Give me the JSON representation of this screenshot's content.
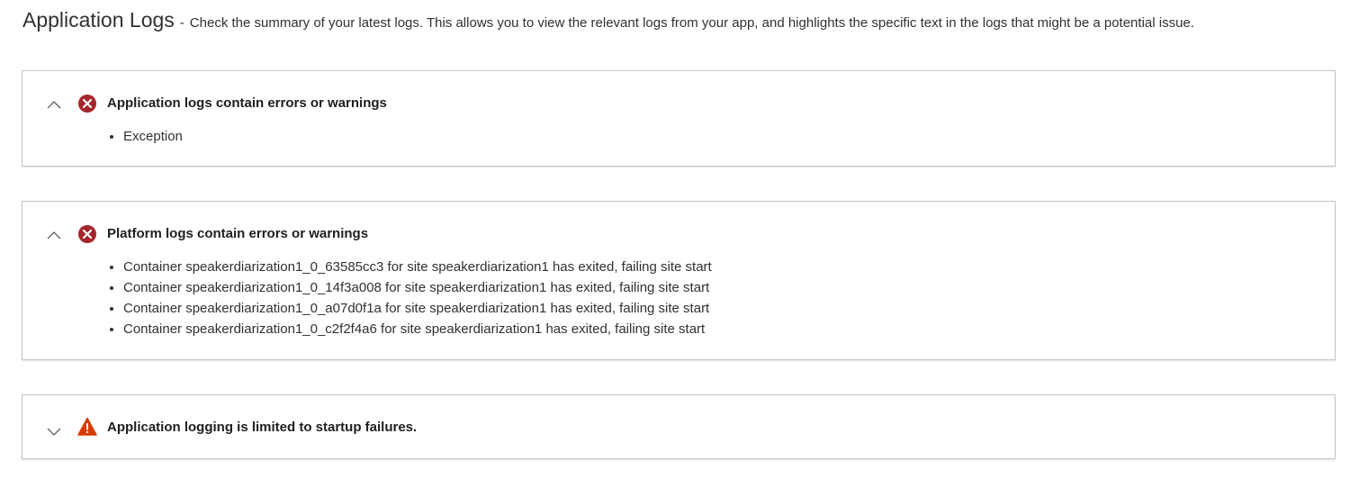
{
  "header": {
    "title": "Application Logs",
    "separator": "-",
    "description": "Check the summary of your latest logs. This allows you to view the relevant logs from your app, and highlights the specific text in the logs that might be a potential issue."
  },
  "cards": [
    {
      "title": "Application logs contain errors or warnings",
      "status": "error",
      "expanded": true,
      "items": [
        "Exception"
      ]
    },
    {
      "title": "Platform logs contain errors or warnings",
      "status": "error",
      "expanded": true,
      "items": [
        "Container speakerdiarization1_0_63585cc3 for site speakerdiarization1 has exited, failing site start",
        "Container speakerdiarization1_0_14f3a008 for site speakerdiarization1 has exited, failing site start",
        "Container speakerdiarization1_0_a07d0f1a for site speakerdiarization1 has exited, failing site start",
        "Container speakerdiarization1_0_c2f2f4a6 for site speakerdiarization1 has exited, failing site start"
      ]
    },
    {
      "title": "Application logging is limited to startup failures.",
      "status": "warning",
      "expanded": false,
      "items": []
    }
  ],
  "colors": {
    "error": "#a4262c",
    "warning": "#d83b01",
    "border": "#c8c6c4"
  },
  "icons": {
    "expanded": "chevron-up-icon",
    "collapsed": "chevron-down-icon",
    "error": "error-circle-icon",
    "warning": "warning-triangle-icon"
  }
}
